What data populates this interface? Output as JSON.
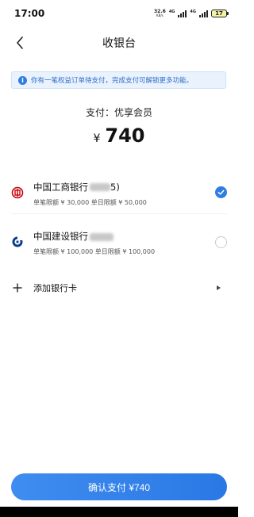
{
  "status_bar": {
    "time": "17:00",
    "net_speed": "32.6",
    "net_unit": "KB/s",
    "signal1_label": "4G",
    "signal2_label": "4G",
    "battery": "17"
  },
  "nav": {
    "title": "收银台",
    "back_icon": "chevron-left-icon"
  },
  "notice": {
    "icon": "info-icon",
    "text": "你有一笔权益订单待支付，完成支付可解锁更多功能。"
  },
  "payment": {
    "label": "支付：优享会员",
    "currency": "¥",
    "amount": "740"
  },
  "banks": [
    {
      "name_prefix": "中国工商银行",
      "name_suffix": "5)",
      "limit": "单笔限额 ¥ 30,000 单日限额 ¥ 50,000",
      "selected": true
    },
    {
      "name_prefix": "中国建设银行",
      "name_suffix": "",
      "limit": "单笔限额 ¥ 100,000 单日限额 ¥ 100,000",
      "selected": false
    }
  ],
  "add_card": {
    "label": "添加银行卡"
  },
  "confirm": {
    "label": "确认支付 ¥740"
  },
  "colors": {
    "accent": "#2f7de1",
    "notice_bg": "#e9f2fd",
    "icbc_red": "#c7000b",
    "ccb_blue": "#0a3c8c"
  }
}
